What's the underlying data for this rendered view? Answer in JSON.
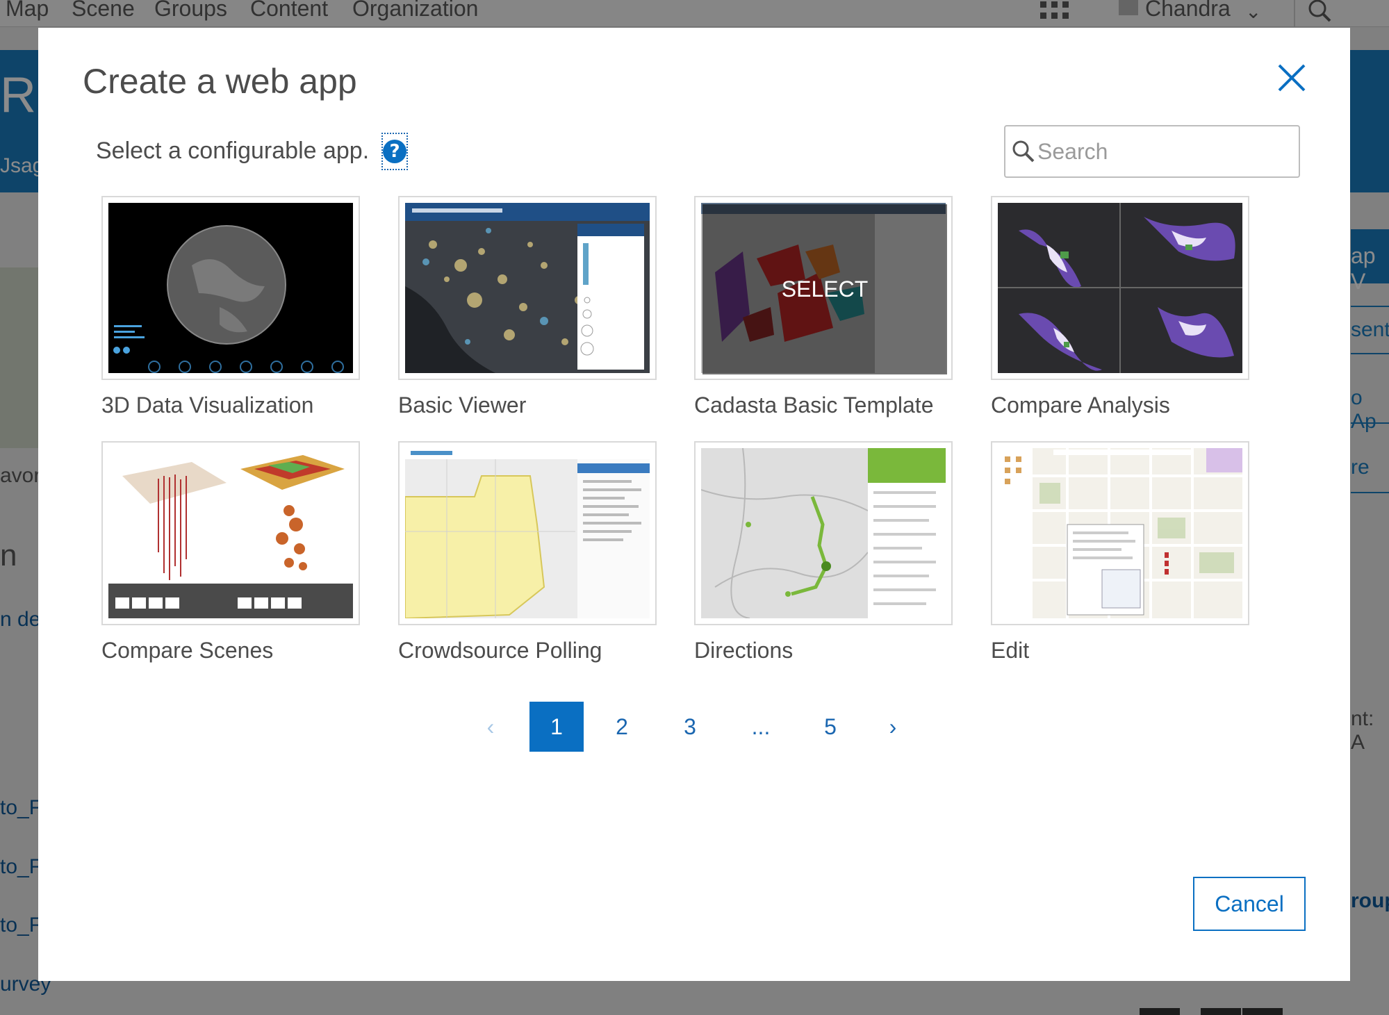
{
  "background": {
    "nav_items": [
      "Map",
      "Scene",
      "Groups",
      "Content",
      "Organization"
    ],
    "user_name": "Chandra",
    "blue_band_text": "Ro",
    "usage_text": "Jsag",
    "left_fragments": [
      "avori",
      "n",
      "n des",
      "to_F",
      "to_F",
      "to_F",
      "urvey"
    ],
    "right_fragments": [
      "ap V",
      "sent",
      "o Ap",
      "re",
      "nt:  A",
      "roup"
    ]
  },
  "modal": {
    "title": "Create a web app",
    "subtitle": "Select a configurable app.",
    "help_symbol": "?",
    "search_placeholder": "Search",
    "select_overlay_text": "SELECT",
    "apps": [
      {
        "label": "3D Data Visualization",
        "icon": "globe-thumbnail"
      },
      {
        "label": "Basic Viewer",
        "icon": "map-thumbnail"
      },
      {
        "label": "Cadasta Basic Template",
        "icon": "parcel-map-thumbnail"
      },
      {
        "label": "Compare Analysis",
        "icon": "quad-map-thumbnail"
      },
      {
        "label": "Compare Scenes",
        "icon": "3d-scene-thumbnail"
      },
      {
        "label": "Crowdsource Polling",
        "icon": "polling-map-thumbnail"
      },
      {
        "label": "Directions",
        "icon": "route-map-thumbnail"
      },
      {
        "label": "Edit",
        "icon": "street-map-thumbnail"
      }
    ],
    "pagination": {
      "prev": "‹",
      "pages": [
        "1",
        "2",
        "3",
        "...",
        "5"
      ],
      "next": "›",
      "current": "1"
    },
    "cancel_label": "Cancel"
  },
  "colors": {
    "accent": "#0a6fc2",
    "overlay": "rgba(0,0,0,0.45)"
  }
}
